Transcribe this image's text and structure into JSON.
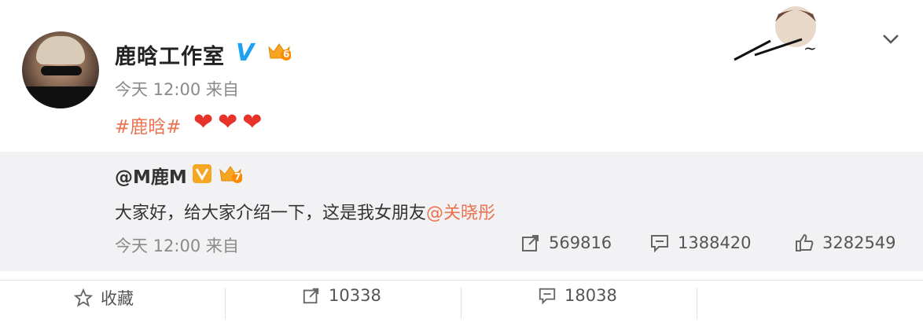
{
  "post": {
    "author_name": "鹿晗工作室",
    "verified_mark": "V",
    "level_badge": "6",
    "meta": "今天 12:00 来自",
    "hashtag": "#鹿晗#",
    "hearts": "❤❤❤"
  },
  "repost": {
    "author_name": "@M鹿M",
    "level_badge": "7",
    "text_main": "大家好，给大家介绍一下，这是我女朋友",
    "mention": "@关晓彤",
    "meta": "今天 12:00 来自",
    "stats": {
      "share_count": "569816",
      "comment_count": "1388420",
      "like_count": "3282549"
    }
  },
  "toolbar": {
    "favorite_label": "收藏",
    "share_count": "10338",
    "comment_count": "18038"
  },
  "colors": {
    "accent_orange": "#eb7350",
    "verified_blue": "#1da1f2",
    "quote_bg": "#f2f2f5"
  },
  "icons": [
    "chevron-down-icon",
    "verified-icon",
    "crown-level-icon",
    "share-icon",
    "comment-icon",
    "like-icon",
    "star-icon"
  ]
}
